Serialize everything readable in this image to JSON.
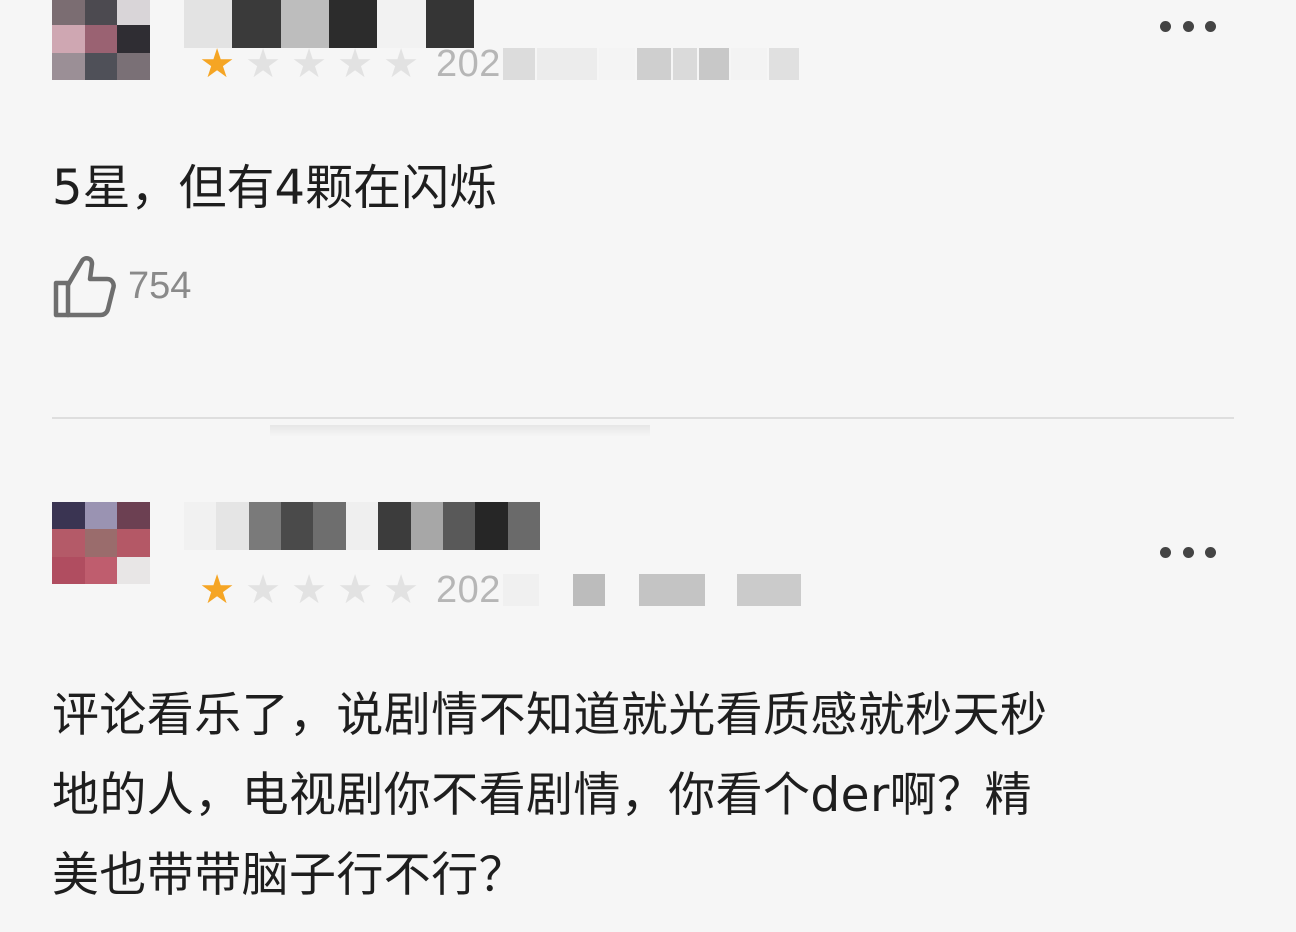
{
  "reviews": [
    {
      "rating": 1,
      "rating_max": 5,
      "date_prefix": "202",
      "text": "5星，但有4颗在闪烁",
      "likes": "754",
      "more_icon": "more-horizontal-icon",
      "like_icon": "thumbs-up-icon"
    },
    {
      "rating": 1,
      "rating_max": 5,
      "date_prefix": "202",
      "text_lines": [
        "评论看乐了，说剧情不知道就光看质感就秒天秒",
        "地的人，电视剧你不看剧情，你看个der啊？精",
        "美也带带脑子行不行？"
      ],
      "more_icon": "more-horizontal-icon"
    }
  ],
  "colors": {
    "star_active": "#f5a524",
    "star_inactive": "#e2e2e2",
    "background": "#f6f6f6",
    "divider": "#dedede"
  }
}
